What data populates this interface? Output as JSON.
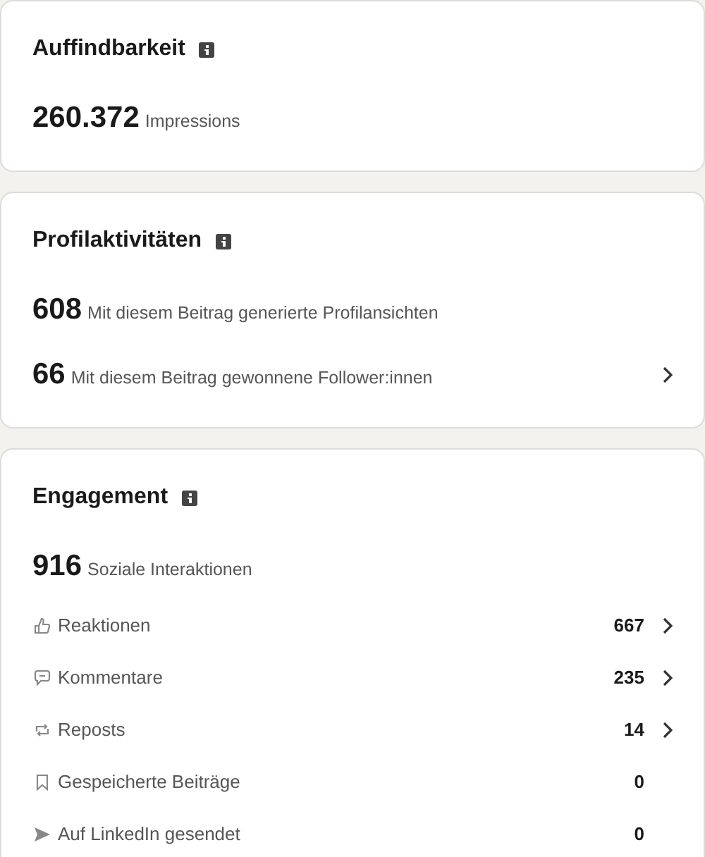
{
  "sections": [
    {
      "title": "Auffindbarkeit",
      "metrics": [
        {
          "value": "260.372",
          "label": "Impressions",
          "linked": false
        }
      ]
    },
    {
      "title": "Profilaktivitäten",
      "metrics": [
        {
          "value": "608",
          "label": "Mit diesem Beitrag generierte Profilansichten",
          "linked": false
        },
        {
          "value": "66",
          "label": "Mit diesem Beitrag gewonnene Follower:innen",
          "linked": true
        }
      ]
    },
    {
      "title": "Engagement",
      "metrics": [
        {
          "value": "916",
          "label": "Soziale Interaktionen",
          "linked": false
        }
      ],
      "items": [
        {
          "kind": "reactions",
          "label": "Reaktionen",
          "value": "667",
          "linked": true
        },
        {
          "kind": "comments",
          "label": "Kommentare",
          "value": "235",
          "linked": true
        },
        {
          "kind": "reposts",
          "label": "Reposts",
          "value": "14",
          "linked": true
        },
        {
          "kind": "saved",
          "label": "Gespeicherte Beiträge",
          "value": "0",
          "linked": false
        },
        {
          "kind": "sent",
          "label": "Auf LinkedIn gesendet",
          "value": "0",
          "linked": false
        }
      ]
    }
  ]
}
